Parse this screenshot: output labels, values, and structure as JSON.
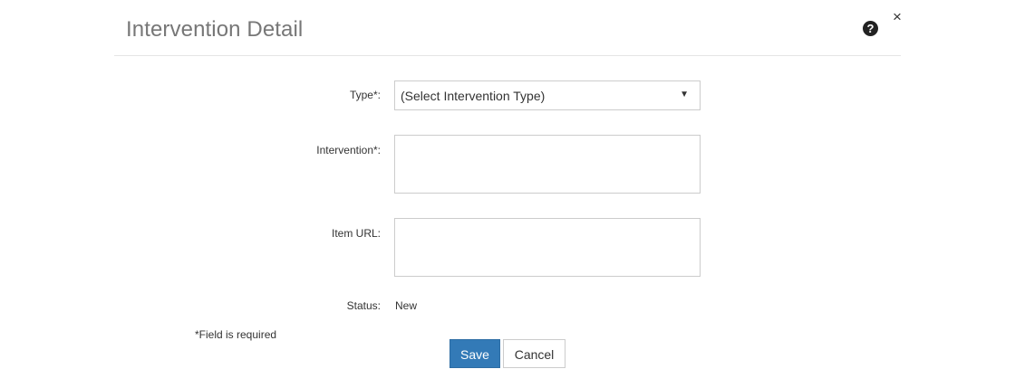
{
  "dialog": {
    "title": "Intervention Detail",
    "help_icon": "question-circle-icon",
    "close_glyph": "×"
  },
  "form": {
    "type_label": "Type*:",
    "type_selected": "(Select Intervention Type)",
    "intervention_label": "Intervention*:",
    "intervention_value": "",
    "item_url_label": "Item URL:",
    "item_url_value": "",
    "status_label": "Status:",
    "status_value": "New",
    "required_note": "*Field is required"
  },
  "buttons": {
    "save_label": "Save",
    "cancel_label": "Cancel"
  },
  "colors": {
    "primary": "#337ab7",
    "title": "#777777",
    "border": "#cccccc"
  }
}
